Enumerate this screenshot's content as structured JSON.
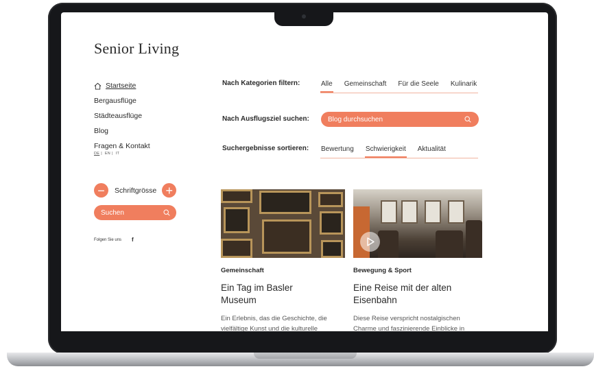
{
  "brand": {
    "logo": "Senior Living"
  },
  "sidebar": {
    "nav": [
      {
        "label": "Startseite"
      },
      {
        "label": "Bergausflüge"
      },
      {
        "label": "Städteausflüge"
      },
      {
        "label": "Blog"
      },
      {
        "label": "Fragen & Kontakt"
      }
    ],
    "languages": [
      "DE",
      "EN",
      "IT"
    ],
    "font_size": {
      "minus": "−",
      "label": "Schriftgrösse",
      "plus": "+"
    },
    "search": {
      "placeholder": "Suchen"
    },
    "follow": {
      "label": "Folgen Sie uns",
      "facebook": "f"
    }
  },
  "filters": {
    "category": {
      "label": "Nach Kategorien filtern:",
      "tabs": [
        "Alle",
        "Gemeinschaft",
        "Für die Seele",
        "Kulinarik"
      ]
    },
    "destination": {
      "label": "Nach Ausflugsziel suchen:",
      "placeholder": "Blog durchsuchen"
    },
    "sort": {
      "label": "Suchergebnisse sortieren:",
      "tabs": [
        "Bewertung",
        "Schwierigkeit",
        "Aktualität"
      ]
    }
  },
  "cards": [
    {
      "category": "Gemeinschaft",
      "title": "Ein Tag im Basler Museum",
      "text": "Ein Erlebnis, das die Geschichte, die vielfältige Kunst und die kulturelle"
    },
    {
      "category": "Bewegung & Sport",
      "title": "Eine Reise mit der alten Eisenbahn",
      "text": "Diese Reise verspricht nostalgischen Charme und faszinierende Einblicke in"
    }
  ],
  "colors": {
    "accent": "#f07e5e",
    "text": "#2a2a2a"
  }
}
